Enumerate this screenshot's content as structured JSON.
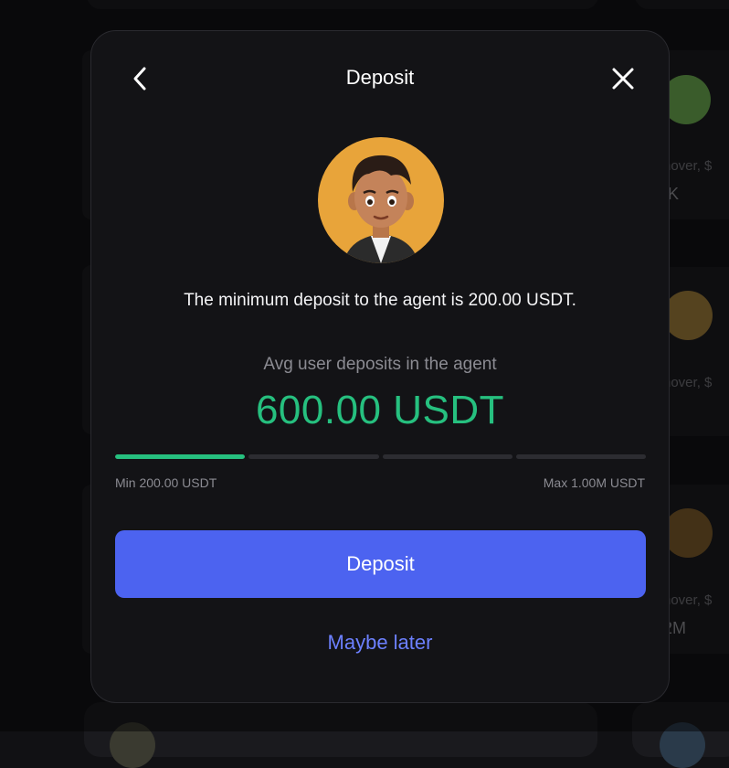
{
  "background": {
    "cards": [
      {
        "label_partial": "nover, $",
        "value_partial": ".K"
      },
      {
        "label_partial": "nover, $",
        "value_partial": "("
      },
      {
        "label_partial": "nover, $",
        "value_partial": "2M"
      }
    ]
  },
  "modal": {
    "title": "Deposit",
    "back_icon": "chevron-left-icon",
    "close_icon": "close-icon",
    "min_deposit_text": "The minimum deposit to the agent is 200.00 USDT.",
    "avg_label": "Avg user deposits in the agent",
    "avg_value": "600.00 USDT",
    "progress_fraction": 0.25,
    "range_min": "Min 200.00 USDT",
    "range_max": "Max 1.00M USDT",
    "deposit_button": "Deposit",
    "maybe_later": "Maybe later"
  },
  "colors": {
    "accent_green": "#26c07f",
    "button_blue": "#4c63f0",
    "link_blue": "#6c80ff",
    "avatar_bg": "#e8a43a"
  }
}
